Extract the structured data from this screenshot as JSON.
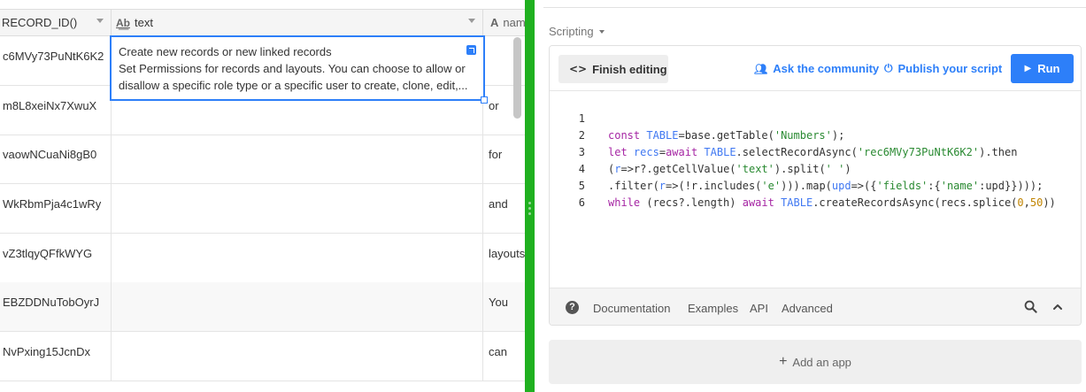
{
  "grid": {
    "columns": [
      {
        "label": "RECORD_ID()",
        "icon": "formula-icon"
      },
      {
        "label": "text",
        "icon": "long-text-icon",
        "icon_glyph": "A͟b"
      },
      {
        "label": "nam",
        "icon": "single-line-text-icon",
        "icon_glyph": "A"
      }
    ],
    "expanded_cell": {
      "lines": [
        "Create new records or new linked records",
        "Set Permissions for records and layouts. You can choose to allow or",
        "disallow a specific role type or a specific user to create, clone, edit,..."
      ]
    },
    "rows": [
      {
        "id": "c6MVy73PuNtK6K2",
        "text": "",
        "name": ""
      },
      {
        "id": "m8L8xeiNx7XwuX",
        "text": "",
        "name": "or"
      },
      {
        "id": "vaowNCuaNi8gB0",
        "text": "",
        "name": "for"
      },
      {
        "id": "WkRbmPja4c1wRy",
        "text": "",
        "name": "and"
      },
      {
        "id": "vZ3tlqyQFfkWYG",
        "text": "",
        "name": "layouts"
      },
      {
        "id": "EBZDDNuTobOyrJ",
        "text": "",
        "name": "You"
      },
      {
        "id": "NvPxing15JcnDx",
        "text": "",
        "name": "can"
      }
    ]
  },
  "panel": {
    "title": "Scripting",
    "finish_label": "Finish editing",
    "ask_label": "Ask the community",
    "publish_label": "Publish your script",
    "run_label": "Run",
    "code_lines": [
      "const TABLE=base.getTable('Numbers');",
      "let recs=await TABLE.selectRecordAsync('rec6MVy73PuNtK6K2').then",
      "(r=>r?.getCellValue('text').split(' ')",
      ".filter(r=>(!r.includes('e'))).map(upd=>({'fields':{'name':upd}})));",
      "while (recs?.length) await TABLE.createRecordsAsync(recs.splice(0,50))",
      ""
    ],
    "doc_links": {
      "documentation": "Documentation",
      "examples": "Examples",
      "api": "API",
      "advanced": "Advanced"
    },
    "add_app_label": "Add an app"
  },
  "colors": {
    "accent": "#2d7ff9",
    "divider": "#1fb01f",
    "keyword": "#a626a4",
    "variable": "#4078f2",
    "string": "#2a8a32",
    "number": "#c18401"
  }
}
